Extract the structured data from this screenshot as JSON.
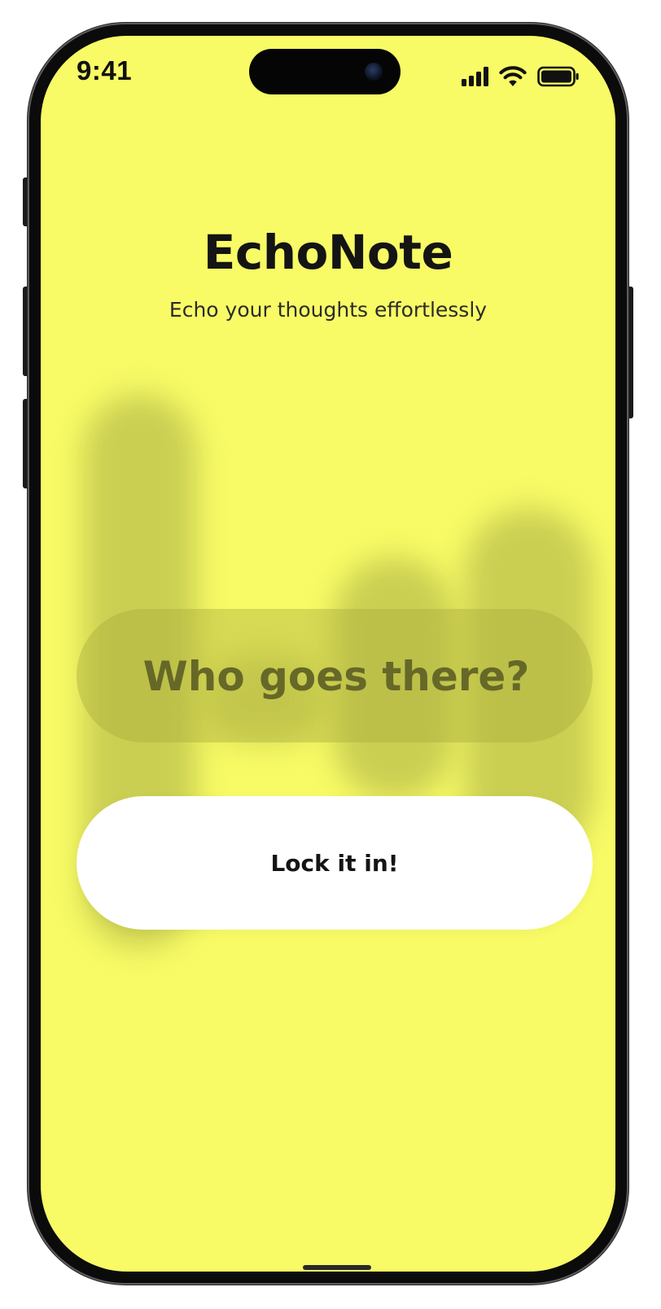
{
  "status_bar": {
    "time": "9:41",
    "icons": [
      "cellular-signal-icon",
      "wifi-icon",
      "battery-icon"
    ]
  },
  "app": {
    "title": "EchoNote",
    "tagline": "Echo your thoughts effortlessly"
  },
  "name_input": {
    "placeholder": "Who goes there?",
    "value": ""
  },
  "primary_button": {
    "label": "Lock it in!"
  },
  "colors": {
    "background": "#f8fb65",
    "input_fill": "#c5c84a",
    "button_fill": "#ffffff",
    "text_primary": "#141414"
  }
}
